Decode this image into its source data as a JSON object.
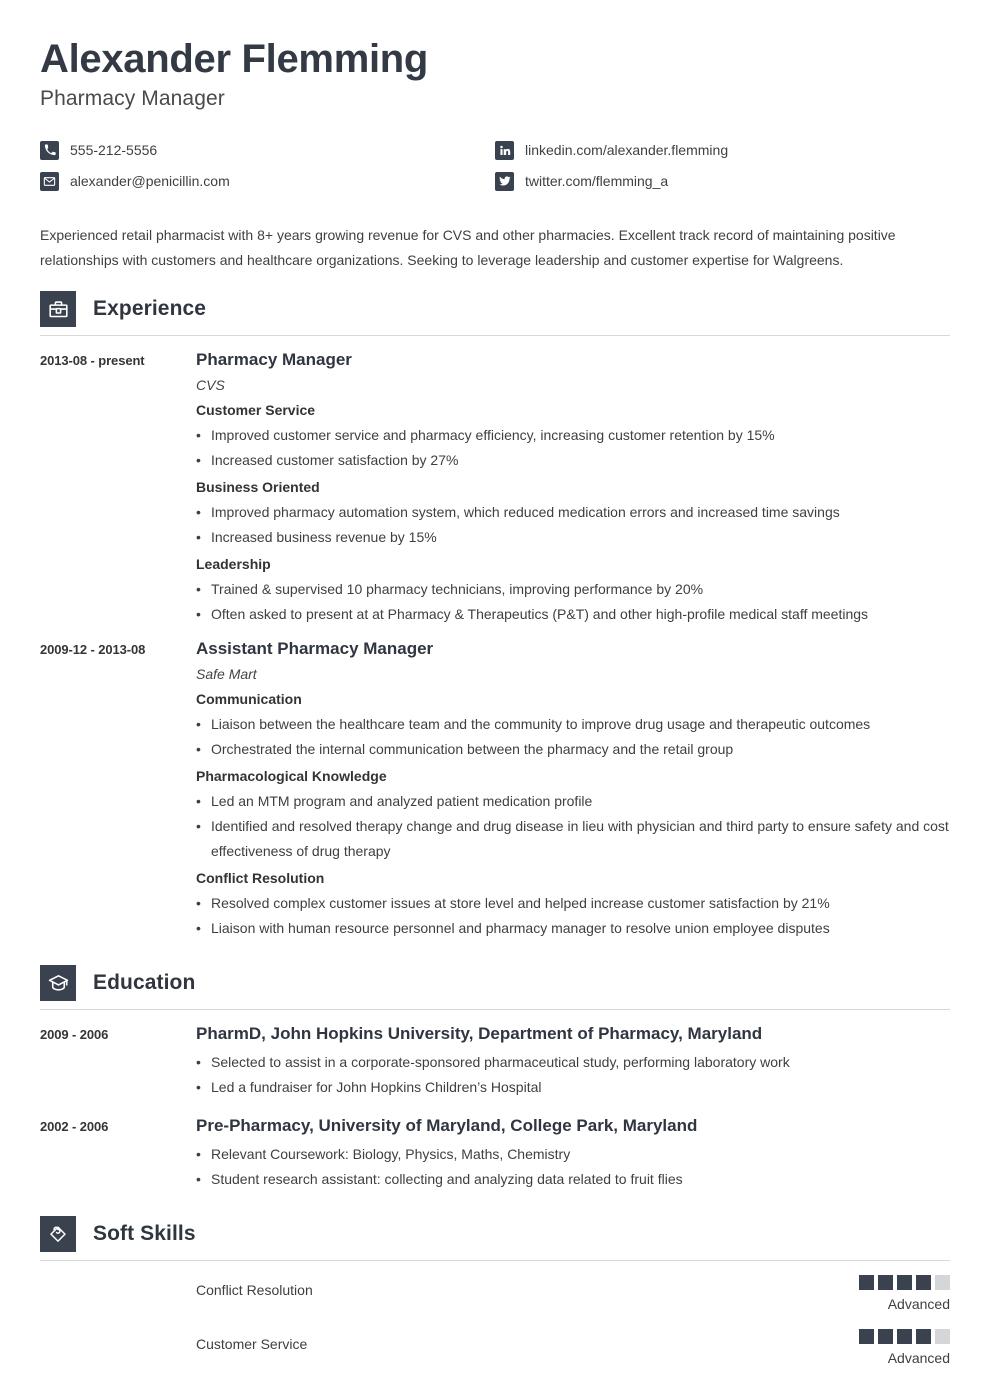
{
  "header": {
    "name": "Alexander Flemming",
    "job_title": "Pharmacy Manager",
    "contacts": [
      {
        "icon": "phone-icon",
        "text": "555-212-5556"
      },
      {
        "icon": "linkedin-icon",
        "text": "linkedin.com/alexander.flemming"
      },
      {
        "icon": "email-icon",
        "text": "alexander@penicillin.com"
      },
      {
        "icon": "twitter-icon",
        "text": "twitter.com/flemming_a"
      }
    ]
  },
  "summary": "Experienced retail pharmacist with 8+ years growing revenue for CVS and other pharmacies. Excellent track record of maintaining positive relationships with customers and healthcare organizations. Seeking to leverage leadership and customer expertise for Walgreens.",
  "sections": {
    "experience": {
      "title": "Experience",
      "icon": "briefcase-icon",
      "entries": [
        {
          "date": "2013-08 - present",
          "title": "Pharmacy Manager",
          "org": "CVS",
          "groups": [
            {
              "heading": "Customer Service",
              "bullets": [
                "Improved customer service and pharmacy efficiency, increasing customer retention by 15%",
                "Increased customer satisfaction by 27%"
              ]
            },
            {
              "heading": "Business Oriented",
              "bullets": [
                "Improved pharmacy automation system, which reduced medication errors and increased time savings",
                "Increased business revenue by 15%"
              ]
            },
            {
              "heading": "Leadership",
              "bullets": [
                "Trained & supervised 10 pharmacy technicians, improving performance by 20%",
                "Often asked to present at at Pharmacy & Therapeutics (P&T) and other high-profile medical staff meetings"
              ]
            }
          ]
        },
        {
          "date": "2009-12 - 2013-08",
          "title": "Assistant Pharmacy Manager",
          "org": "Safe Mart",
          "groups": [
            {
              "heading": "Communication",
              "bullets": [
                "Liaison between the healthcare team and the community to improve drug usage and therapeutic outcomes",
                "Orchestrated the internal communication between the pharmacy and the retail group"
              ]
            },
            {
              "heading": "Pharmacological Knowledge",
              "bullets": [
                "Led an MTM program and analyzed patient medication profile",
                "Identified and resolved therapy change and drug disease in lieu with physician and third party to ensure safety and cost effectiveness of drug therapy"
              ]
            },
            {
              "heading": "Conflict Resolution",
              "bullets": [
                "Resolved complex customer issues at store level and helped increase customer satisfaction by 21%",
                "Liaison with human resource personnel and pharmacy manager to resolve union employee disputes"
              ]
            }
          ]
        }
      ]
    },
    "education": {
      "title": "Education",
      "icon": "graduation-cap-icon",
      "entries": [
        {
          "date": "2009 - 2006",
          "title": "PharmD, John Hopkins University, Department of Pharmacy, Maryland",
          "bullets": [
            "Selected to assist in a corporate-sponsored pharmaceutical study, performing laboratory work",
            "Led a fundraiser for John Hopkins Children’s Hospital"
          ]
        },
        {
          "date": "2002 - 2006",
          "title": "Pre-Pharmacy, University of Maryland, College Park, Maryland",
          "bullets": [
            "Relevant Coursework: Biology, Physics, Maths, Chemistry",
            "Student research assistant: collecting and analyzing data related to fruit flies"
          ]
        }
      ]
    },
    "soft_skills": {
      "title": "Soft Skills",
      "icon": "hand-heart-icon",
      "items": [
        {
          "name": "Conflict Resolution",
          "level": "Advanced",
          "filled": 4,
          "total": 5
        },
        {
          "name": "Customer Service",
          "level": "Advanced",
          "filled": 4,
          "total": 5
        }
      ]
    }
  },
  "colors": {
    "accent_dark": "#3a4250",
    "heading": "#2f3640",
    "body_text": "#3f3f3f",
    "rule": "#d8d8d8",
    "square_off": "#d5d6d8"
  }
}
